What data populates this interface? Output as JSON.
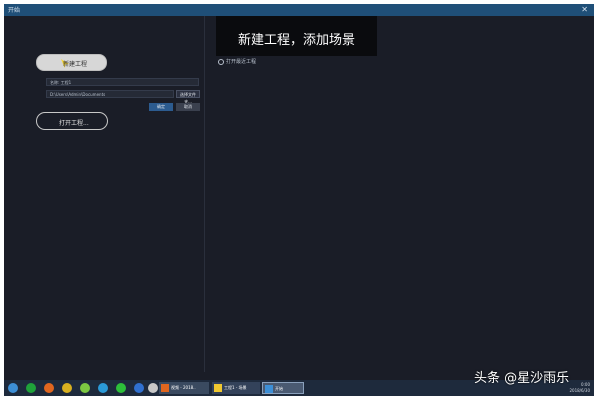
{
  "window": {
    "title": "开始",
    "close_glyph": "✕"
  },
  "left": {
    "new_project_label": "新建工程",
    "project_name": "名称: 工程1",
    "project_path": "D:\\Users\\Admin\\Documents",
    "browse_label": "选择文件夹...",
    "ok_label": "确定",
    "cancel_label": "取消",
    "open_project_label": "打开工程..."
  },
  "banner": {
    "text": "新建工程，添加场景"
  },
  "recent": {
    "label": "打开最近工程"
  },
  "taskbar": {
    "apps": [
      {
        "name": "start-orb",
        "color": "#3d8fd6"
      },
      {
        "name": "browser-icon",
        "color": "#1fa23a"
      },
      {
        "name": "firefox-icon",
        "color": "#e0661f"
      },
      {
        "name": "chrome-icon",
        "color": "#d8b020"
      },
      {
        "name": "app-icon",
        "color": "#7cc842"
      },
      {
        "name": "media-icon",
        "color": "#2b9ad8"
      },
      {
        "name": "wechat-icon",
        "color": "#2dbf3a"
      },
      {
        "name": "bluetooth-icon",
        "color": "#3070d0"
      },
      {
        "name": "tool-icon",
        "color": "#c8c8c8"
      }
    ],
    "tasks": [
      {
        "label": "视频 - 2018..",
        "color": "#e0661f"
      },
      {
        "label": "工程1 - 场景",
        "color": "#f0c830"
      },
      {
        "label": "开始",
        "color": "#3d8fd6"
      }
    ],
    "clock": {
      "time": "0:00",
      "date": "2018/6/30"
    }
  },
  "watermark": {
    "text": "头条 @星沙雨乐"
  }
}
